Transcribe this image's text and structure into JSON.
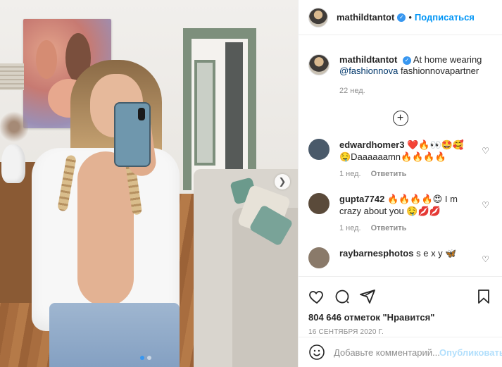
{
  "post": {
    "username": "mathildtantot",
    "follow_label": "Подписаться",
    "separator": "•",
    "caption_user": "mathildtantot",
    "caption_prefix": "At home wearing",
    "caption_mention": "@fashionnova",
    "caption_suffix": "fashionnovapartner",
    "caption_time": "22 нед.",
    "load_more_symbol": "+",
    "carousel": {
      "total_images": 2,
      "active_index": 0
    }
  },
  "comments": [
    {
      "username": "edwardhomer3",
      "text": "❤️🔥👀🤩🥰\n🤤Daaaaaamn🔥🔥🔥🔥",
      "time": "1 нед.",
      "reply": "Ответить",
      "avatar_color": "#4a5a6a"
    },
    {
      "username": "gupta7742",
      "text": "🔥🔥🔥🔥😍 I m crazy about you 🤤💋💋",
      "time": "1 нед.",
      "reply": "Ответить",
      "avatar_color": "#5a4a3a"
    },
    {
      "username": "raybarnesphotos",
      "text": "s e x y 🦋",
      "time": "",
      "reply": "",
      "avatar_color": "#8a7a6a"
    }
  ],
  "actions": {
    "likes": "804 646 отметок \"Нравится\"",
    "date": "16 СЕНТЯБРЯ 2020 Г.",
    "comment_placeholder": "Добавьте комментарий...",
    "publish": "Опубликовать"
  },
  "icons": {
    "like": "heart-icon",
    "comment": "comment-icon",
    "share": "share-icon",
    "save": "bookmark-icon",
    "emoji": "emoji-icon",
    "next": "chevron-right-icon"
  },
  "colors": {
    "accent": "#0095f6",
    "verified": "#3897f0",
    "muted": "#8e8e8e",
    "publish_disabled": "#b2dffc"
  }
}
